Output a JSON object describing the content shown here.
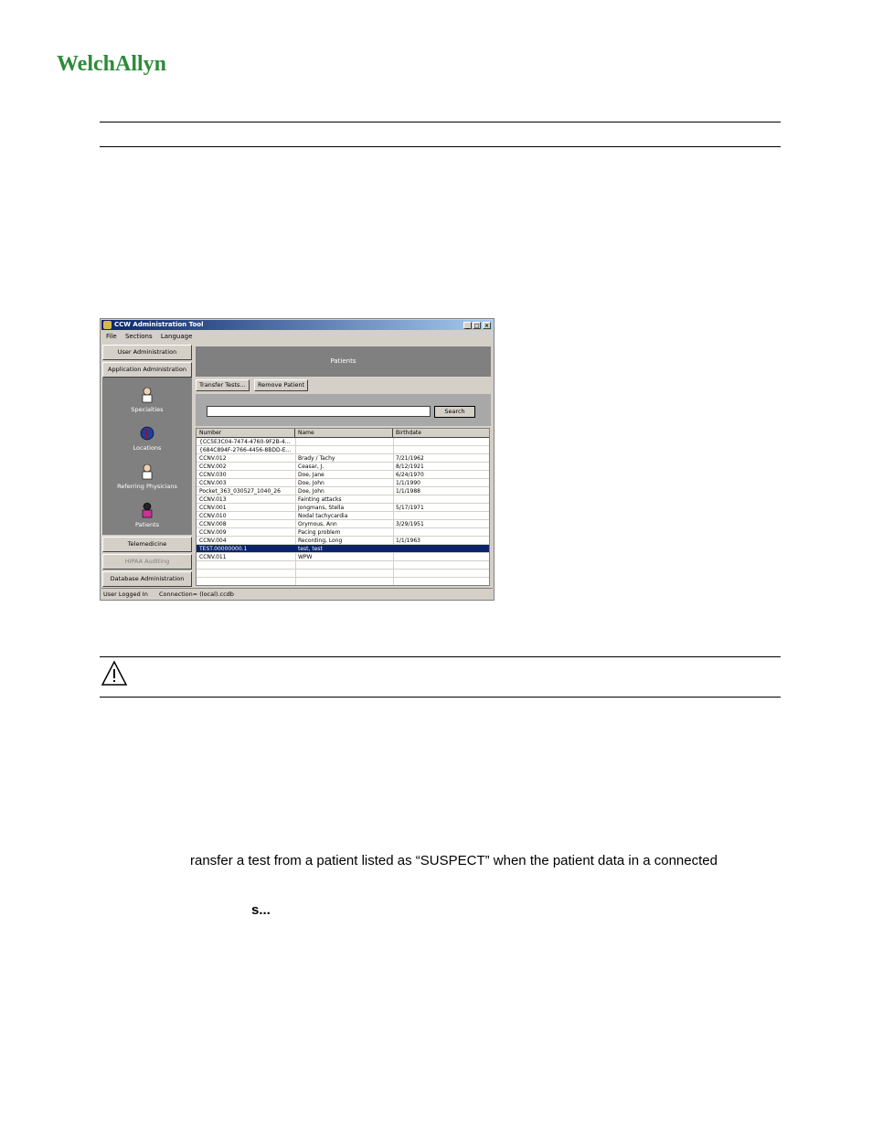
{
  "logo": {
    "text": "WelchAllyn",
    "brand_color": "#2e8b3a"
  },
  "window": {
    "title": "CCW Administration Tool",
    "menu": [
      "File",
      "Sections",
      "Language"
    ],
    "nav": {
      "user_admin": "User Administration",
      "app_admin": "Application Administration",
      "items": [
        "Specialties",
        "Locations",
        "Referring Physicians",
        "Patients"
      ],
      "telemedicine": "Telemedicine",
      "hipaa": "HIPAA Auditing",
      "db_admin": "Database Administration"
    },
    "header": "Patients",
    "toolbar": {
      "transfer": "Transfer Tests...",
      "remove": "Remove Patient"
    },
    "search": {
      "button": "Search",
      "value": ""
    },
    "columns": [
      "Number",
      "Name",
      "Birthdate"
    ],
    "rows": [
      [
        "{CC5E3C04-7474-4760-9F2B-4...",
        "",
        ""
      ],
      [
        "{684C894F-2766-4456-8BDD-E...",
        "",
        ""
      ],
      [
        "CCNV.012",
        "Brady / Tachy",
        "7/21/1962"
      ],
      [
        "CCNV.002",
        "Ceasar, J.",
        "8/12/1921"
      ],
      [
        "CCNV.030",
        "Doe, Jane",
        "6/24/1970"
      ],
      [
        "CCNV.003",
        "Doe, John",
        "1/1/1990"
      ],
      [
        "Pocket_363_030527_1040_26",
        "Doe, John",
        "1/1/1988"
      ],
      [
        "CCNV.013",
        "Fainting attacks",
        ""
      ],
      [
        "CCNV.001",
        "Jongmans, Stella",
        "5/17/1971"
      ],
      [
        "CCNV.010",
        "Nodal tachycardia",
        ""
      ],
      [
        "CCNV.008",
        "Orymous, Ann",
        "3/29/1951"
      ],
      [
        "CCNV.009",
        "Pacing problem",
        ""
      ],
      [
        "CCNV.004",
        "Recording, Long",
        "1/1/1963"
      ],
      [
        "TEST.00000000.1",
        "test, test",
        ""
      ],
      [
        "CCNV.011",
        "WPW",
        ""
      ]
    ],
    "selected_row": 13,
    "status": {
      "user": "User Logged In",
      "connection": "Connection= (local).ccdb"
    }
  },
  "text": {
    "line1": "ransfer a test from a patient listed as “SUSPECT” when the patient data in a connected",
    "line2": "s..."
  }
}
